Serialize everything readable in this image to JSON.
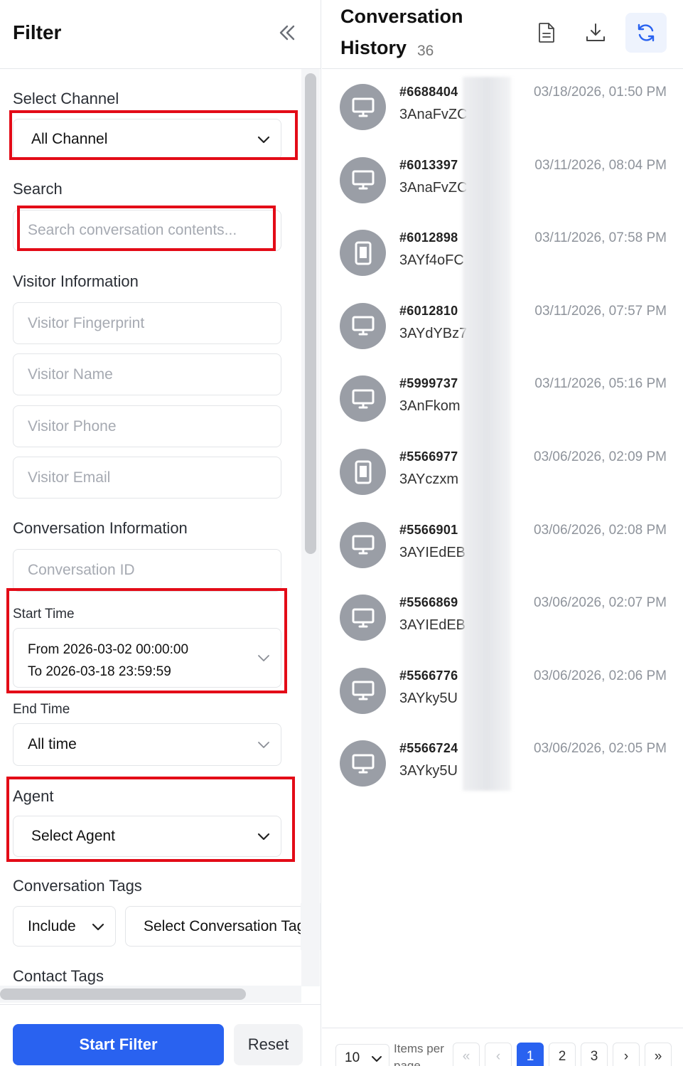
{
  "filter": {
    "title": "Filter",
    "select_channel": {
      "label": "Select Channel",
      "value": "All Channel"
    },
    "search": {
      "label": "Search",
      "placeholder": "Search conversation contents..."
    },
    "visitor_info": {
      "label": "Visitor Information",
      "fingerprint_placeholder": "Visitor Fingerprint",
      "name_placeholder": "Visitor Name",
      "phone_placeholder": "Visitor Phone",
      "email_placeholder": "Visitor Email"
    },
    "conversation_info": {
      "label": "Conversation Information",
      "id_placeholder": "Conversation ID"
    },
    "start_time": {
      "label": "Start Time",
      "from": "From 2026-03-02 00:00:00",
      "to": "To 2026-03-18 23:59:59"
    },
    "end_time": {
      "label": "End Time",
      "value": "All time"
    },
    "agent": {
      "label": "Agent",
      "value": "Select Agent"
    },
    "conversation_tags": {
      "label": "Conversation Tags",
      "mode": "Include",
      "placeholder": "Select Conversation Tags"
    },
    "contact_tags": {
      "label": "Contact Tags"
    },
    "start_filter_label": "Start Filter",
    "reset_label": "Reset"
  },
  "history": {
    "title_line1": "Conversation",
    "title_line2": "History",
    "count": "36",
    "icons": {
      "doc": "document-icon",
      "download": "download-icon",
      "refresh": "refresh-icon"
    },
    "rows": [
      {
        "id": "#6688404",
        "visitor": "3AnaFvZC",
        "time": "03/18/2026, 01:50 PM",
        "device": "desktop"
      },
      {
        "id": "#6013397",
        "visitor": "3AnaFvZC",
        "time": "03/11/2026, 08:04 PM",
        "device": "desktop"
      },
      {
        "id": "#6012898",
        "visitor": "3AYf4oFC",
        "time": "03/11/2026, 07:58 PM",
        "device": "tablet"
      },
      {
        "id": "#6012810",
        "visitor": "3AYdYBz7",
        "time": "03/11/2026, 07:57 PM",
        "device": "desktop"
      },
      {
        "id": "#5999737",
        "visitor": "3AnFkom",
        "time": "03/11/2026, 05:16 PM",
        "device": "desktop"
      },
      {
        "id": "#5566977",
        "visitor": "3AYczxm",
        "time": "03/06/2026, 02:09 PM",
        "device": "tablet"
      },
      {
        "id": "#5566901",
        "visitor": "3AYIEdEB",
        "time": "03/06/2026, 02:08 PM",
        "device": "desktop"
      },
      {
        "id": "#5566869",
        "visitor": "3AYIEdEB",
        "time": "03/06/2026, 02:07 PM",
        "device": "desktop"
      },
      {
        "id": "#5566776",
        "visitor": "3AYky5U",
        "time": "03/06/2026, 02:06 PM",
        "device": "desktop"
      },
      {
        "id": "#5566724",
        "visitor": "3AYky5U",
        "time": "03/06/2026, 02:05 PM",
        "device": "desktop"
      }
    ],
    "pagination": {
      "page_size": "10",
      "items_per_page": "Items per page",
      "pages": [
        "1",
        "2",
        "3"
      ],
      "current": "1",
      "first": "«",
      "prev": "‹",
      "next": "›",
      "last": "»"
    }
  },
  "colors": {
    "primary": "#2962f0",
    "highlight": "#e30b17",
    "avatar": "#9a9ea6"
  }
}
